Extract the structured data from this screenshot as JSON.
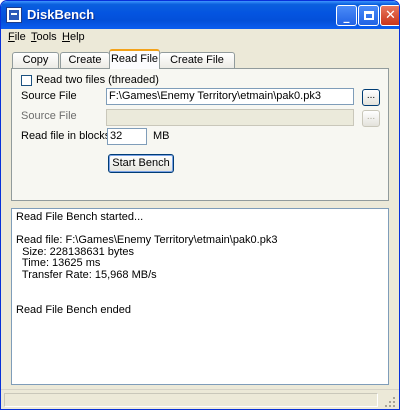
{
  "window": {
    "title": "DiskBench"
  },
  "menu": [
    {
      "label": "File"
    },
    {
      "label": "Tools"
    },
    {
      "label": "Help"
    }
  ],
  "tabs": [
    {
      "label": "Copy File"
    },
    {
      "label": "Create File"
    },
    {
      "label": "Read File"
    },
    {
      "label": "Create File Batch"
    }
  ],
  "read_file": {
    "two_files_label": "Read two files (threaded)",
    "two_files_checked": false,
    "source1_label": "Source File",
    "source1_value": "F:\\Games\\Enemy Territory\\etmain\\pak0.pk3",
    "source2_label": "Source File",
    "source2_value": "",
    "browse_label": "...",
    "blocks_label": "Read file in blocks of",
    "blocks_value": "32",
    "blocks_unit": "MB",
    "start_label": "Start Bench"
  },
  "log": [
    "Read File Bench started...",
    "",
    "Read file: F:\\Games\\Enemy Territory\\etmain\\pak0.pk3",
    "  Size: 228138631 bytes",
    "  Time: 13625 ms",
    "  Transfer Rate: 15,968 MB/s",
    "",
    "",
    "Read File Bench ended"
  ],
  "colors": {
    "titlebar": "#0454e0",
    "active_tab_accent": "#f3a21a",
    "window_bg": "#ece9d8"
  }
}
